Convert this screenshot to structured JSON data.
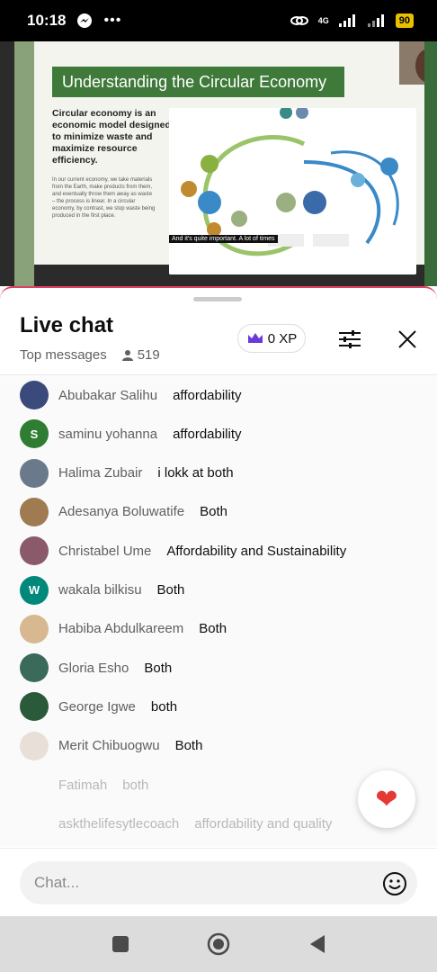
{
  "status_bar": {
    "time": "10:18",
    "network": "4G",
    "battery": "90"
  },
  "video": {
    "slide_title": "Understanding the Circular Economy",
    "slide_lead": "Circular economy is an economic model designed to minimize waste and maximize resource efficiency.",
    "slide_body": "In our current economy, we take materials from the Earth, make products from them, and eventually throw them away as waste – the process is linear. In a circular economy, by contrast, we stop waste being produced in the first place.",
    "caption": "And it's quite important. A lot of times"
  },
  "chat": {
    "title": "Live chat",
    "subtitle": "Top messages",
    "viewer_count": "519",
    "xp_label": "0 XP",
    "input_placeholder": "Chat...",
    "messages": [
      {
        "author": "Abubakar Salihu",
        "text": "affordability",
        "avatar_color": "#3a4a7a",
        "initial": ""
      },
      {
        "author": "saminu yohanna",
        "text": "affordability",
        "avatar_color": "#2e7d32",
        "initial": "S"
      },
      {
        "author": "Halima Zubair",
        "text": "i lokk at both",
        "avatar_color": "#6a7a8a",
        "initial": ""
      },
      {
        "author": "Adesanya Boluwatife",
        "text": "Both",
        "avatar_color": "#a07a50",
        "initial": ""
      },
      {
        "author": "Christabel Ume",
        "text": "Affordability and Sustainability",
        "avatar_color": "#8a5a6a",
        "initial": ""
      },
      {
        "author": "wakala bilkisu",
        "text": "Both",
        "avatar_color": "#00897b",
        "initial": "W"
      },
      {
        "author": "Habiba Abdulkareem",
        "text": "Both",
        "avatar_color": "#d8b890",
        "initial": ""
      },
      {
        "author": "Gloria Esho",
        "text": "Both",
        "avatar_color": "#3a6a5a",
        "initial": ""
      },
      {
        "author": "George Igwe",
        "text": "both",
        "avatar_color": "#2a5a3a",
        "initial": ""
      },
      {
        "author": "Merit Chibuogwu",
        "text": "Both",
        "avatar_color": "#e8e0d8",
        "initial": ""
      },
      {
        "author": "Fatimah",
        "text": "both",
        "avatar_color": "",
        "initial": "",
        "faded": true
      },
      {
        "author": "askthelifesytlecoach",
        "text": "affordability and quality",
        "avatar_color": "",
        "initial": "",
        "faded": true
      }
    ]
  }
}
